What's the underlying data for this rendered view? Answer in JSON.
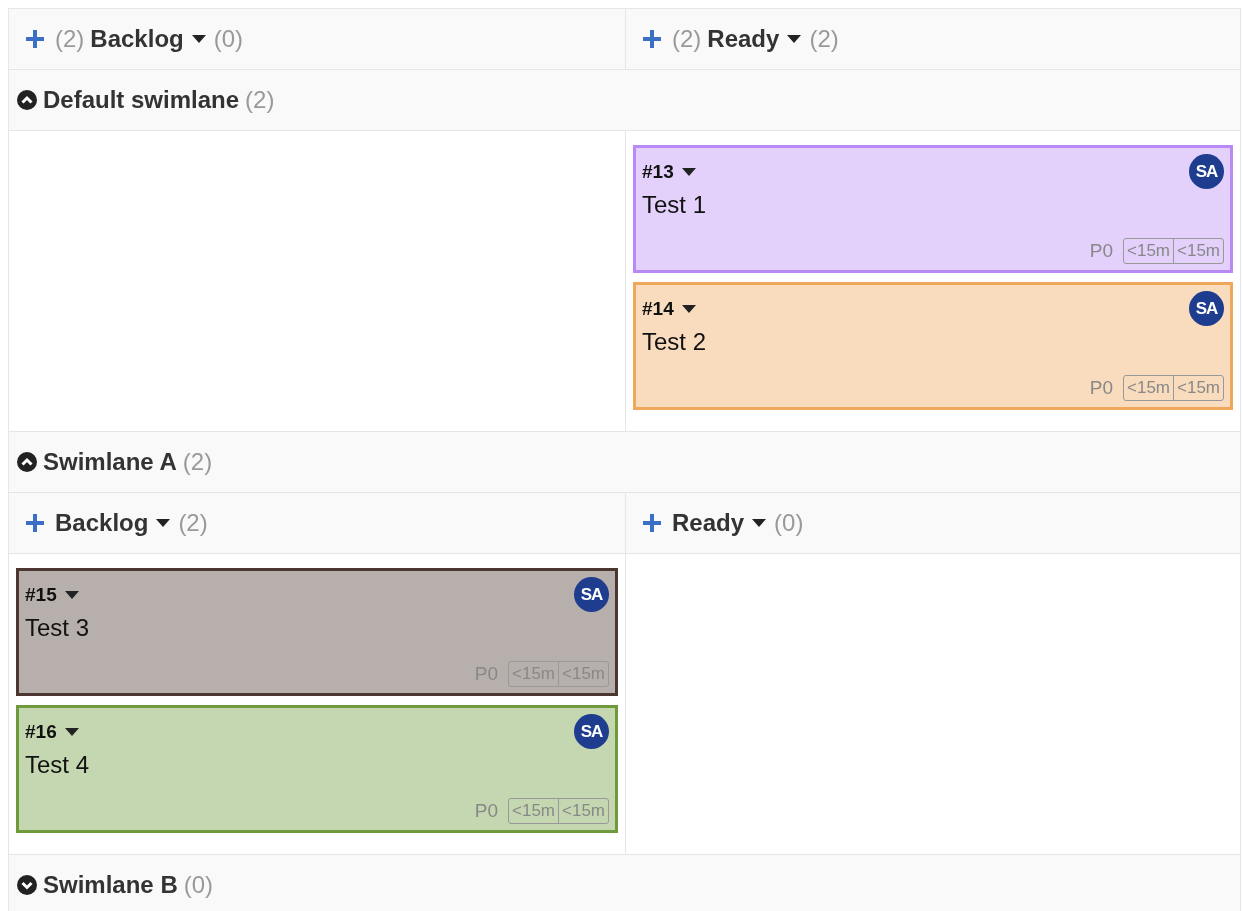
{
  "columns": [
    {
      "label": "Backlog",
      "task_count": "(2)",
      "card_count": "(0)"
    },
    {
      "label": "Ready",
      "task_count": "(2)",
      "card_count": "(2)"
    }
  ],
  "swimlanes": [
    {
      "name": "Default swimlane",
      "count": "(2)",
      "expanded": true,
      "cells": [
        [],
        [
          {
            "id": "#13",
            "title": "Test 1",
            "avatar": "SA",
            "priority": "P0",
            "time_estimated": "<15m",
            "time_spent": "<15m",
            "color": "#b98af5"
          },
          {
            "id": "#14",
            "title": "Test 2",
            "avatar": "SA",
            "priority": "P0",
            "time_estimated": "<15m",
            "time_spent": "<15m",
            "color": "#efa85a"
          }
        ]
      ]
    },
    {
      "name": "Swimlane A",
      "count": "(2)",
      "expanded": true,
      "columns": [
        {
          "label": "Backlog",
          "count": "(2)"
        },
        {
          "label": "Ready",
          "count": "(0)"
        }
      ],
      "cells": [
        [
          {
            "id": "#15",
            "title": "Test 3",
            "avatar": "SA",
            "priority": "P0",
            "time_estimated": "<15m",
            "time_spent": "<15m",
            "color": "#4b3630"
          },
          {
            "id": "#16",
            "title": "Test 4",
            "avatar": "SA",
            "priority": "P0",
            "time_estimated": "<15m",
            "time_spent": "<15m",
            "color": "#6e9a3c"
          }
        ],
        []
      ]
    },
    {
      "name": "Swimlane B",
      "count": "(0)",
      "expanded": false
    }
  ]
}
